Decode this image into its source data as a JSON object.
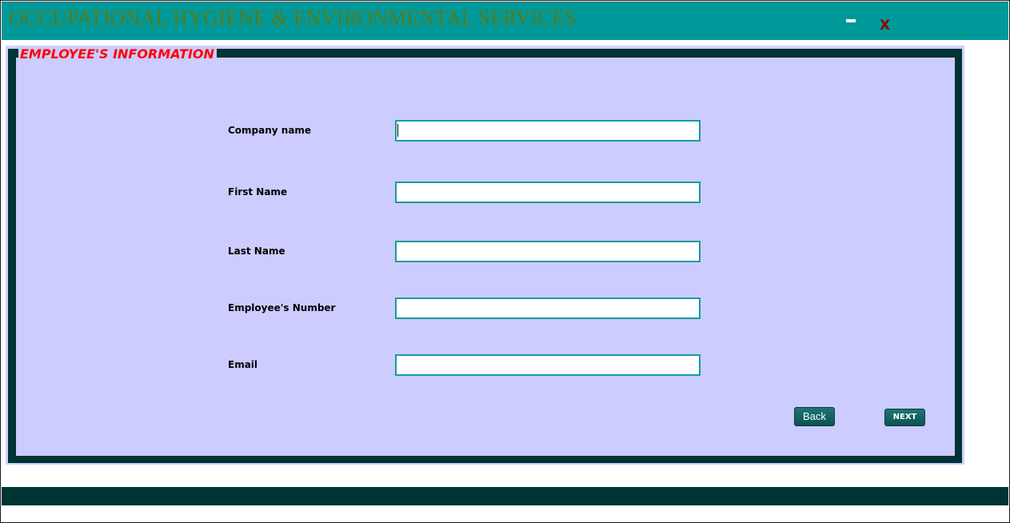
{
  "app": {
    "title": "OCCUPATIONAL HYGIENE & ENVIRONMENTAL SERVICES",
    "minimize_label": "minimize",
    "close_label": "X"
  },
  "panel": {
    "legend": "EMPLOYEE'S INFORMATION"
  },
  "form": {
    "company_name": {
      "label": "Company name",
      "value": ""
    },
    "first_name": {
      "label": "First Name",
      "value": ""
    },
    "last_name": {
      "label": "Last Name",
      "value": ""
    },
    "employee_number": {
      "label": "Employee's Number",
      "value": ""
    },
    "email": {
      "label": "Email",
      "value": ""
    }
  },
  "actions": {
    "back_label": "Back",
    "next_label": "NEXT"
  },
  "colors": {
    "titlebar": "#009999",
    "title_text": "#5a7a14",
    "panel_frame": "#003333",
    "panel_fill": "#ccccff",
    "legend_text": "#ff0000",
    "input_border": "#169c9c",
    "button": "#0c5353",
    "close_icon": "#8b0000"
  },
  "icons": {
    "minimize": "minimize-icon",
    "close": "close-icon"
  }
}
